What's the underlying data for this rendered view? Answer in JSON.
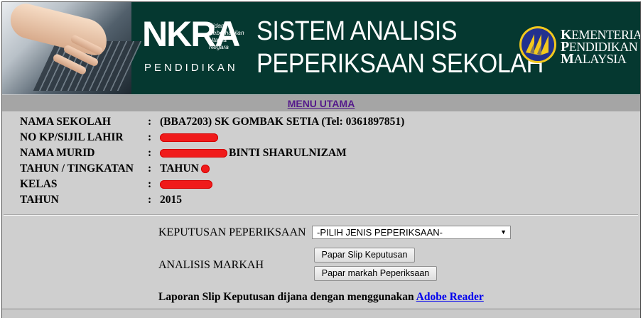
{
  "banner": {
    "brand": "NKRA",
    "brand_tagline": [
      "Bidang",
      "Keberhasilan",
      "Utama",
      "Negara"
    ],
    "brand_sub": "PENDIDIKAN",
    "title_line1": "SISTEM ANALISIS",
    "title_line2": "PEPERIKSAAN SEKOLAH",
    "ministry_line1_initial": "K",
    "ministry_line1_rest": "EMENTERIAN",
    "ministry_line2_initial": "P",
    "ministry_line2_rest": "ENDIDIKAN",
    "ministry_line3_initial": "M",
    "ministry_line3_rest": "ALAYSIA",
    "colors": {
      "background": "#053830",
      "logo_blue": "#22318f",
      "logo_gold": "#f2c81d"
    }
  },
  "menu": {
    "main_menu_label": "MENU UTAMA"
  },
  "info": {
    "rows": [
      {
        "label": "NAMA SEKOLAH",
        "separator": ":",
        "value": "(BBA7203) SK GOMBAK SETIA (Tel: 0361897851)"
      },
      {
        "label": "NO KP/SIJIL LAHIR",
        "separator": ":",
        "value": ""
      },
      {
        "label": "NAMA MURID",
        "separator": ":",
        "value": "BINTI SHARULNIZAM"
      },
      {
        "label": "TAHUN / TINGKATAN",
        "separator": ":",
        "value": "TAHUN"
      },
      {
        "label": "KELAS",
        "separator": ":",
        "value": ""
      },
      {
        "label": "TAHUN",
        "separator": ":",
        "value": "2015"
      }
    ]
  },
  "form": {
    "exam_label": "KEPUTUSAN PEPERIKSAAN",
    "exam_select_value": "-PILIH JENIS PEPERIKSAAN-",
    "analysis_label": "ANALISIS MARKAH",
    "slip_button": "Papar Slip Keputusan",
    "marks_button": "Papar markah Peperiksaan"
  },
  "note": {
    "text": "Laporan Slip Keputusan dijana dengan menggunakan ",
    "link": "Adobe Reader"
  }
}
